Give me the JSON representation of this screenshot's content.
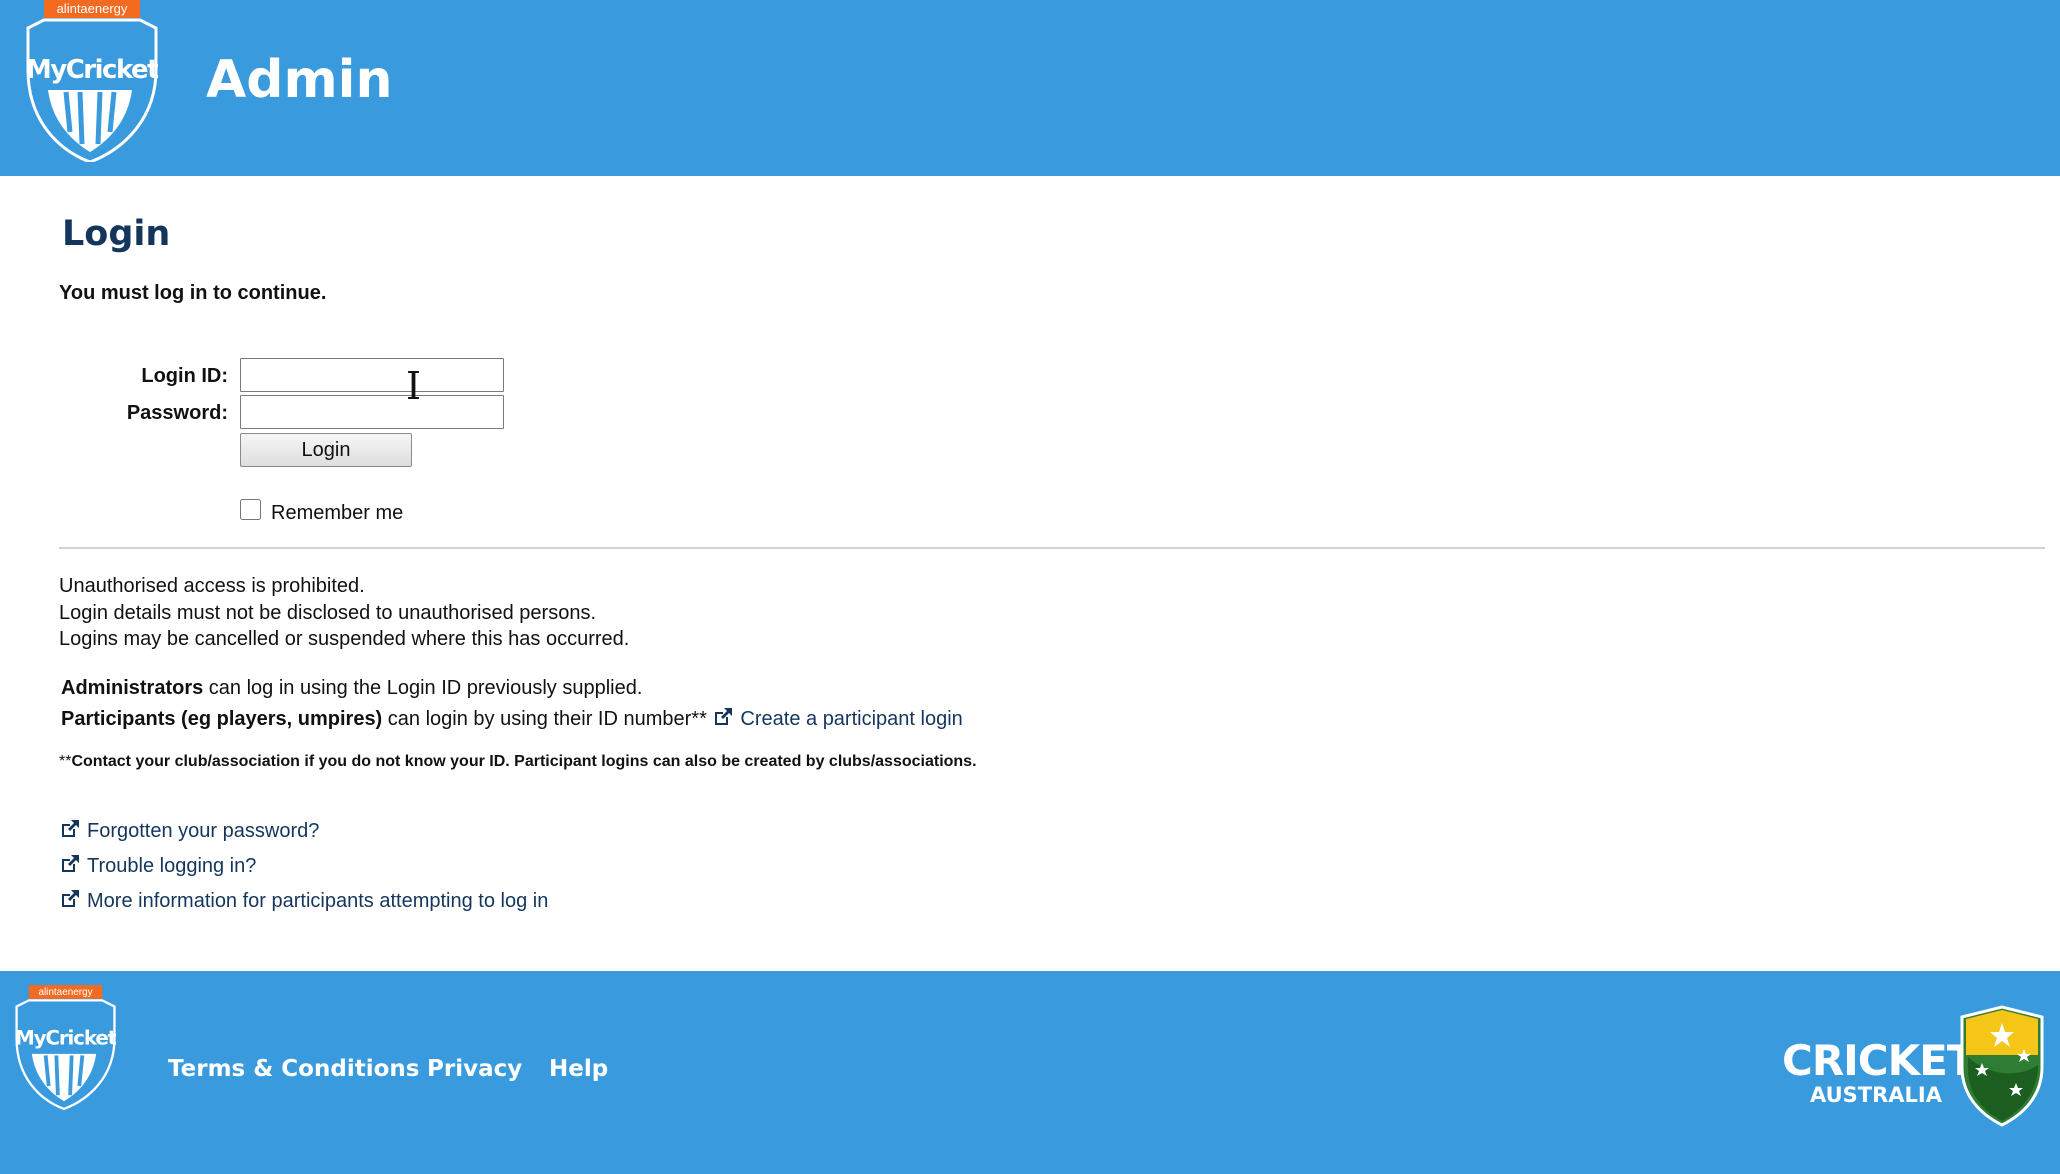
{
  "header": {
    "brand_sponsor": "alintaenergy",
    "brand_name": "MyCricket",
    "title": "Admin"
  },
  "main": {
    "page_title": "Login",
    "must_login": "You must log in to continue.",
    "form": {
      "login_id_label": "Login ID:",
      "login_id_value": "",
      "password_label": "Password:",
      "password_value": "",
      "login_button": "Login",
      "remember_label": "Remember me",
      "remember_checked": false
    },
    "notices": [
      "Unauthorised access is prohibited.",
      "Login details must not be disclosed to unauthorised persons.",
      "Logins may be cancelled or suspended where this has occurred."
    ],
    "info": {
      "admin_bold": "Administrators",
      "admin_text": " can log in using the Login ID previously supplied.",
      "participant_bold": "Participants (eg players, umpires)",
      "participant_text": " can login by using their ID number**",
      "participant_link": "Create a participant login"
    },
    "footnote_stars": "**",
    "footnote": "Contact your club/association if you do not know your ID. Participant logins can also be created by clubs/associations.",
    "help_links": [
      "Forgotten your password?",
      "Trouble logging in?",
      "More information for participants attempting to log in"
    ]
  },
  "footer": {
    "brand_sponsor": "alintaenergy",
    "brand_name": "MyCricket",
    "links": [
      "Terms & Conditions",
      "Privacy",
      "Help"
    ],
    "partner_line1": "CRICKET",
    "partner_line2": "AUSTRALIA"
  },
  "colors": {
    "brand_blue": "#3a9ade",
    "title_navy": "#14365c",
    "sponsor_orange": "#f26b21"
  },
  "icons": [
    "external-link-icon",
    "text-cursor-icon",
    "cricket-australia-shield-icon",
    "mycricket-logo-icon"
  ]
}
